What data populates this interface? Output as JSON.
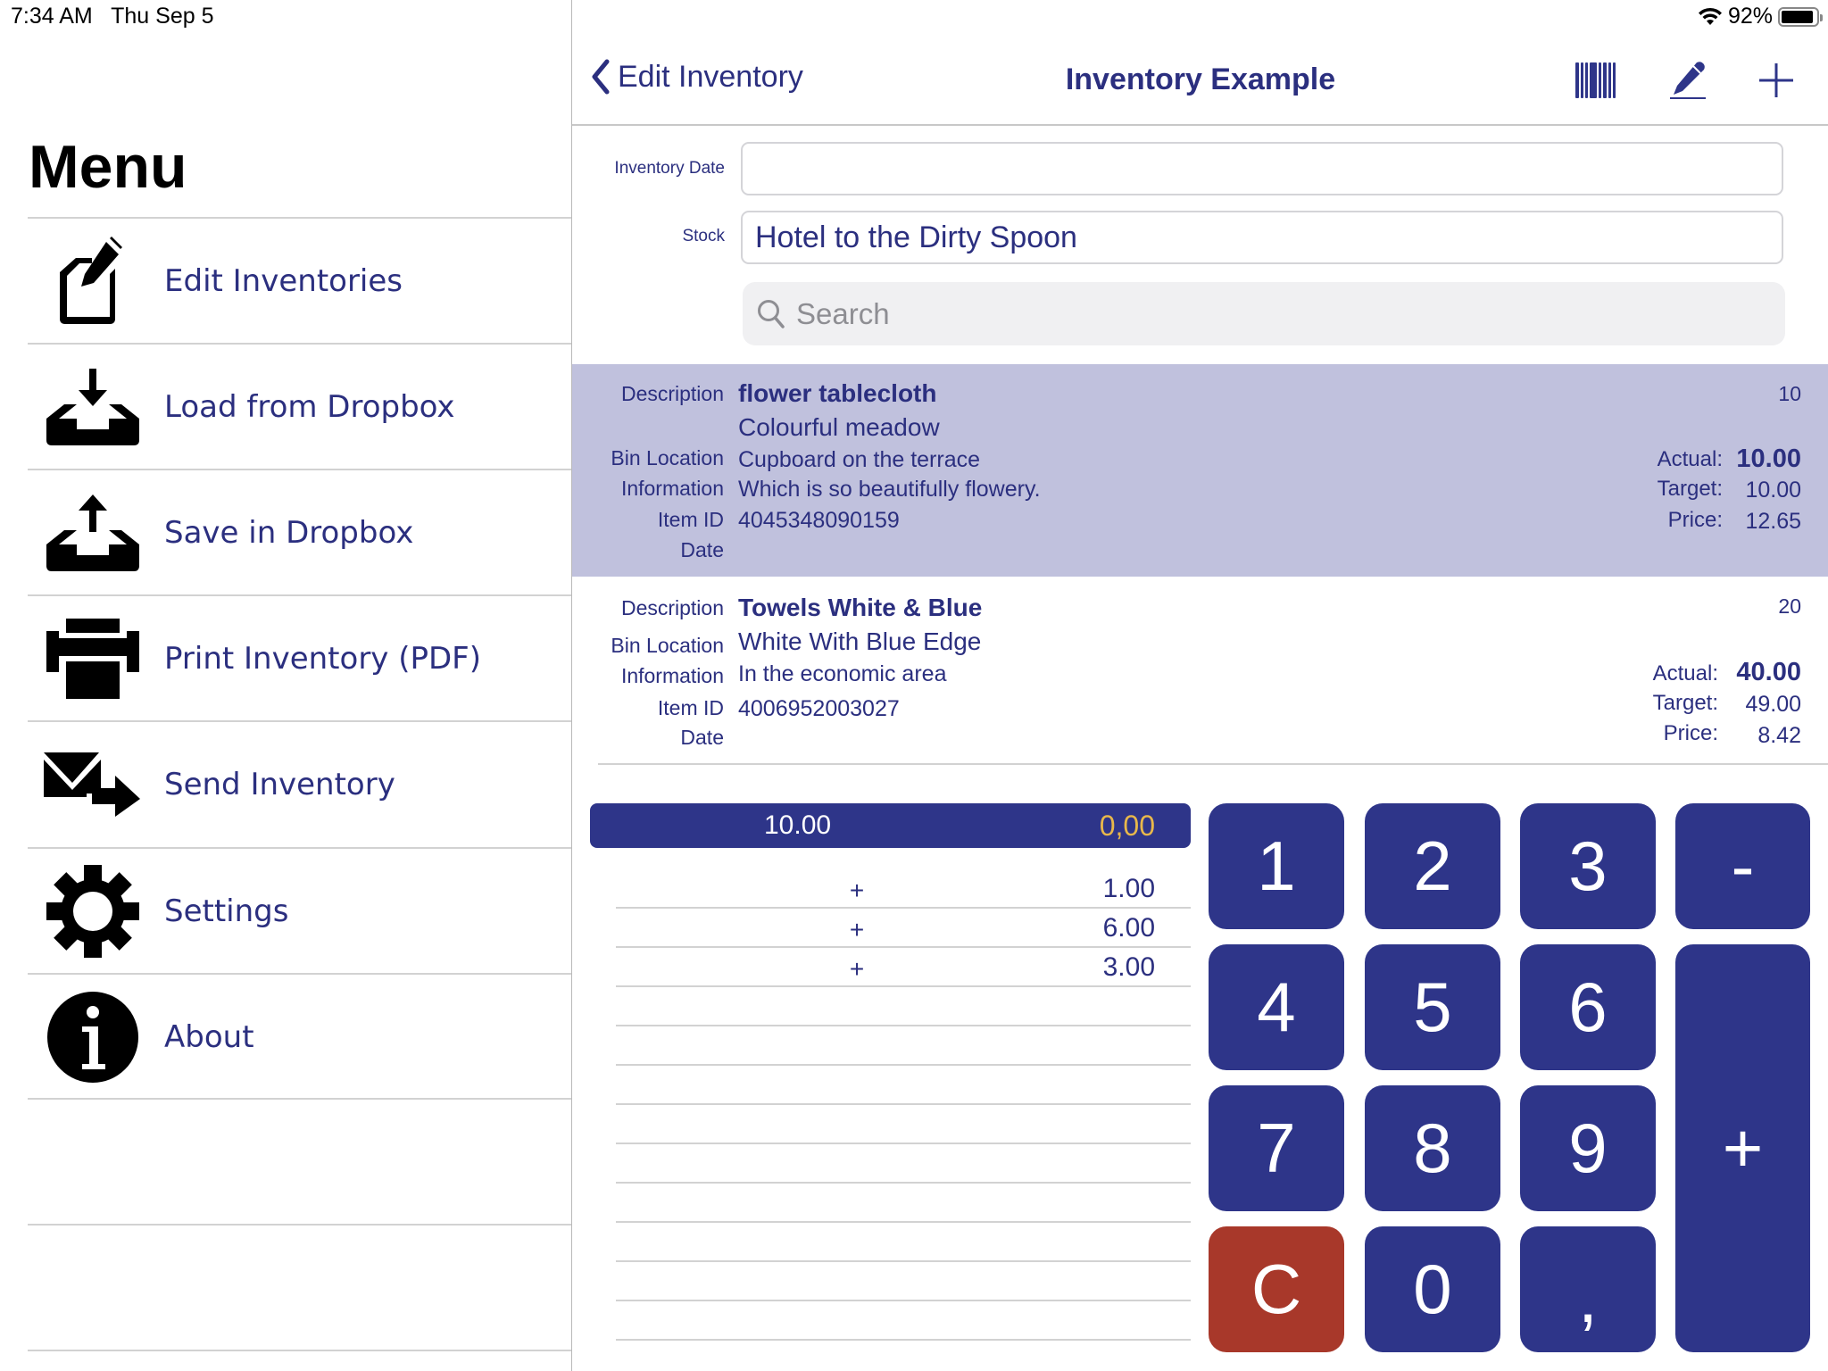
{
  "status_bar": {
    "time": "7:34 AM",
    "date": "Thu Sep 5",
    "battery_percent": "92%",
    "battery_level": 0.92
  },
  "menu": {
    "title": "Menu",
    "items": [
      {
        "label": "Edit Inventories",
        "icon": "edit-document-icon"
      },
      {
        "label": "Load from Dropbox",
        "icon": "download-tray-icon"
      },
      {
        "label": "Save in Dropbox",
        "icon": "upload-tray-icon"
      },
      {
        "label": "Print Inventory (PDF)",
        "icon": "printer-icon"
      },
      {
        "label": "Send Inventory",
        "icon": "mail-send-icon"
      },
      {
        "label": "Settings",
        "icon": "gear-icon"
      },
      {
        "label": "About",
        "icon": "info-icon"
      }
    ]
  },
  "nav": {
    "back_label": "Edit Inventory",
    "title": "Inventory Example",
    "actions": [
      "barcode-icon",
      "pencil-icon",
      "plus-icon"
    ]
  },
  "form": {
    "inventory_date_label": "Inventory Date",
    "inventory_date_value": "",
    "stock_label": "Stock",
    "stock_value": "Hotel to the Dirty Spoon",
    "search_placeholder": "Search"
  },
  "item_labels": {
    "description": "Description",
    "bin_location": "Bin Location",
    "information": "Information",
    "item_id": "Item ID",
    "date": "Date",
    "actual": "Actual:",
    "target": "Target:",
    "price": "Price:"
  },
  "items": [
    {
      "description": "flower tablecloth",
      "subtitle": "Colourful meadow",
      "bin_location": "Cupboard on the terrace",
      "information": "Which is so beautifully flowery.",
      "item_id": "4045348090159",
      "date": "",
      "quantity": "10",
      "actual": "10.00",
      "target": "10.00",
      "price": "12.65",
      "selected": true
    },
    {
      "description": "Towels White & Blue",
      "bin_location": "White With Blue Edge",
      "information": "In the economic area",
      "item_id": "4006952003027",
      "date": "",
      "quantity": "20",
      "actual": "40.00",
      "target": "49.00",
      "price": "8.42",
      "selected": false
    }
  ],
  "calculator": {
    "total": "10.00",
    "input": "0,00",
    "tape": [
      {
        "op": "+",
        "value": "1.00"
      },
      {
        "op": "+",
        "value": "6.00"
      },
      {
        "op": "+",
        "value": "3.00"
      }
    ],
    "keys": {
      "k1": "1",
      "k2": "2",
      "k3": "3",
      "minus": "-",
      "k4": "4",
      "k5": "5",
      "k6": "6",
      "plus": "+",
      "k7": "7",
      "k8": "8",
      "k9": "9",
      "clear": "C",
      "k0": "0",
      "comma": ","
    },
    "colors": {
      "key": "#2e3589",
      "clear": "#a8382a",
      "input_text": "#e8b84b"
    }
  }
}
